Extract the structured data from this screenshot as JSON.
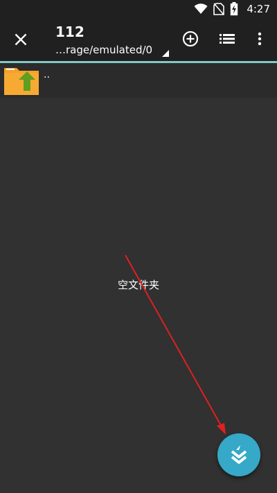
{
  "status_bar": {
    "time": "4:27",
    "icons": [
      "wifi-icon",
      "no-sim-icon",
      "battery-charging-icon"
    ]
  },
  "toolbar": {
    "close_icon": "close-icon",
    "title": "112",
    "path": "…rage/emulated/0",
    "actions": [
      "add-circle-icon",
      "list-view-icon",
      "more-vert-icon"
    ]
  },
  "file_list": {
    "parent_item": {
      "label": "..",
      "icon": "folder-up-icon"
    },
    "empty_message": "空文件夹"
  },
  "fab": {
    "icon": "double-chevron-down-icon"
  },
  "colors": {
    "background": "#313131",
    "toolbar": "#202020",
    "accent_line": "#80cbc4",
    "fab": "#35a9c7",
    "folder": "#f5a02a",
    "folder_arrow": "#5f9e1f",
    "annotation_arrow": "#e02020"
  }
}
